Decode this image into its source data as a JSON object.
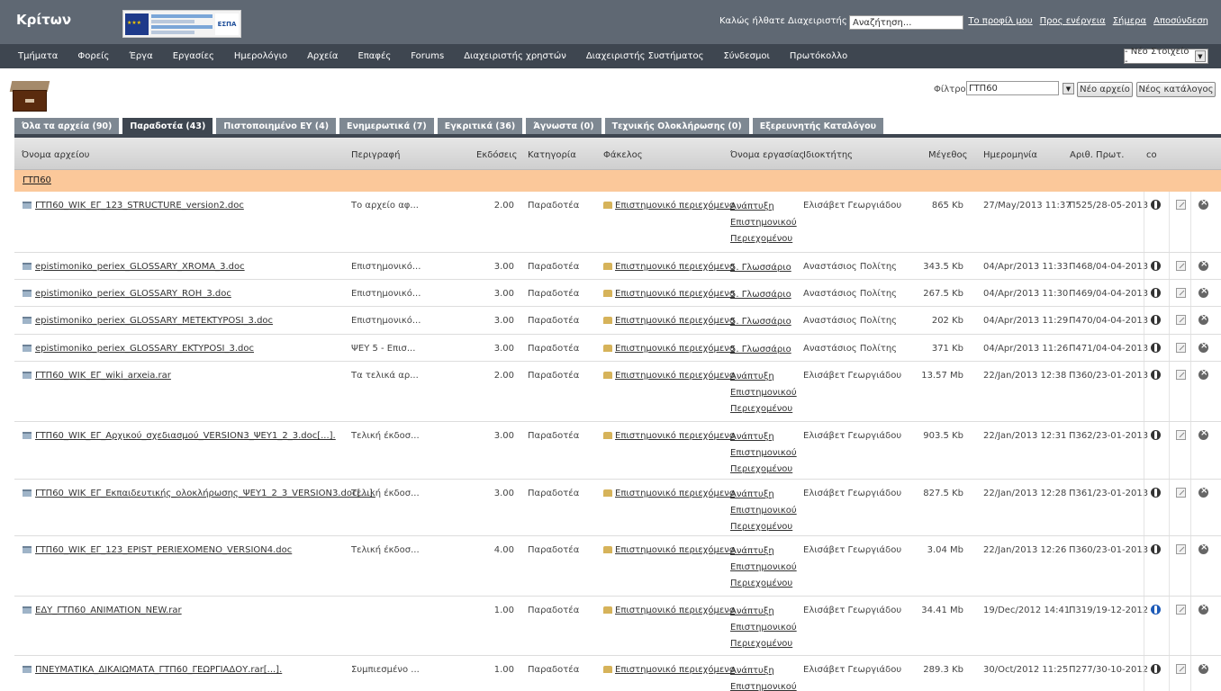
{
  "header": {
    "brand": "Κρίτων",
    "espa_logo": "ΕΣΠΑ",
    "welcome": "Καλώς ήλθατε Διαχειριστής",
    "search_value": "Αναζήτηση...",
    "links": [
      "Το προφίλ μου",
      "Προς ενέργεια",
      "Σήμερα",
      "Αποσύνδεση"
    ]
  },
  "nav": {
    "items": [
      "Τμήματα",
      "Φορείς",
      "Έργα",
      "Εργασίες",
      "Ημερολόγιο",
      "Αρχεία",
      "Επαφές",
      "Forums",
      "Διαχειριστής χρηστών",
      "Διαχειριστής Συστήματος",
      "Σύνδεσμοι",
      "Πρωτόκολλο"
    ],
    "new_item": "- Νέο Στοιχείο -"
  },
  "filter": {
    "label": "Φίλτρο:",
    "value": "ΓΤΠ60",
    "new_file": "Νέο αρχείο",
    "new_dir": "Νέος κατάλογος"
  },
  "tabs": [
    "Όλα τα αρχεία (90)",
    "Παραδοτέα (43)",
    "Πιστοποιημένο ΕΥ (4)",
    "Ενημερωτικά (7)",
    "Εγκριτικά (36)",
    "Άγνωστα (0)",
    "Τεχνικής Ολοκλήρωσης (0)",
    "Εξερευνητής Καταλόγου"
  ],
  "table": {
    "headers": [
      "Όνομα αρχείου",
      "Περιγραφή",
      "Εκδόσεις",
      "Κατηγορία",
      "Φάκελος",
      "Όνομα εργασίας",
      "Ιδιοκτήτης",
      "Μέγεθος",
      "Ημερομηνία",
      "Αριθ. Πρωτ.",
      "co"
    ],
    "group": "ΓΤΠ60",
    "rows": [
      {
        "name": "ΓΤΠ60_WIK_ΕΓ_123_STRUCTURE_version2.doc",
        "desc": "Το αρχείο αφ...",
        "ver": "2.00",
        "cat": "Παραδοτέα",
        "folder": "Επιστημονικό περιεχόμενο",
        "task": [
          "Ανάπτυξη",
          "Επιστημονικού",
          "Περιεχομένου"
        ],
        "owner": "Ελισάβετ Γεωργιάδου",
        "size": "865 Kb",
        "date": "27/May/2013 11:37",
        "prot": "Π525/28-05-2013"
      },
      {
        "name": "epistimoniko_periex_GLOSSARY_XROMA_3.doc",
        "desc": "Επιστημονικό...",
        "ver": "3.00",
        "cat": "Παραδοτέα",
        "folder": "Επιστημονικό περιεχόμενο",
        "task": [
          "5. Γλωσσάριο"
        ],
        "owner": "Αναστάσιος Πολίτης",
        "size": "343.5 Kb",
        "date": "04/Apr/2013 11:33",
        "prot": "Π468/04-04-2013"
      },
      {
        "name": "epistimoniko_periex_GLOSSARY_ROH_3.doc",
        "desc": "Επιστημονικό...",
        "ver": "3.00",
        "cat": "Παραδοτέα",
        "folder": "Επιστημονικό περιεχόμενο",
        "task": [
          "5. Γλωσσάριο"
        ],
        "owner": "Αναστάσιος Πολίτης",
        "size": "267.5 Kb",
        "date": "04/Apr/2013 11:30",
        "prot": "Π469/04-04-2013"
      },
      {
        "name": "epistimoniko_periex_GLOSSARY_METEKTYPOSI_3.doc",
        "desc": "Επιστημονικό...",
        "ver": "3.00",
        "cat": "Παραδοτέα",
        "folder": "Επιστημονικό περιεχόμενο",
        "task": [
          "5. Γλωσσάριο"
        ],
        "owner": "Αναστάσιος Πολίτης",
        "size": "202 Kb",
        "date": "04/Apr/2013 11:29",
        "prot": "Π470/04-04-2013"
      },
      {
        "name": "epistimoniko_periex_GLOSSARY_EKTYPOSI_3.doc",
        "desc": "ΨΕΥ 5 - Επισ...",
        "ver": "3.00",
        "cat": "Παραδοτέα",
        "folder": "Επιστημονικό περιεχόμενο",
        "task": [
          "5. Γλωσσάριο"
        ],
        "owner": "Αναστάσιος Πολίτης",
        "size": "371 Kb",
        "date": "04/Apr/2013 11:26",
        "prot": "Π471/04-04-2013"
      },
      {
        "name": "ΓΤΠ60_WIK_ΕΓ_wiki_arxeia.rar",
        "desc": "Τα τελικά αρ...",
        "ver": "2.00",
        "cat": "Παραδοτέα",
        "folder": "Επιστημονικό περιεχόμενο",
        "task": [
          "Ανάπτυξη",
          "Επιστημονικού",
          "Περιεχομένου"
        ],
        "owner": "Ελισάβετ Γεωργιάδου",
        "size": "13.57 Mb",
        "date": "22/Jan/2013 12:38",
        "prot": "Π360/23-01-2013"
      },
      {
        "name": "ΓΤΠ60_WIK_ΕΓ_Αρχικού_σχεδιασμού_VERSION3_ΨΕΥ1_2_3.doc[...].",
        "desc": "Τελική έκδοσ...",
        "ver": "3.00",
        "cat": "Παραδοτέα",
        "folder": "Επιστημονικό περιεχόμενο",
        "task": [
          "Ανάπτυξη",
          "Επιστημονικού",
          "Περιεχομένου"
        ],
        "owner": "Ελισάβετ Γεωργιάδου",
        "size": "903.5 Kb",
        "date": "22/Jan/2013 12:31",
        "prot": "Π362/23-01-2013"
      },
      {
        "name": "ΓΤΠ60_WIK_ΕΓ_Εκπαιδευτικής_ολοκλήρωσης_ΨΕΥ1_2_3_VERSION3.doc[...].",
        "desc": "Τελική έκδοσ...",
        "ver": "3.00",
        "cat": "Παραδοτέα",
        "folder": "Επιστημονικό περιεχόμενο",
        "task": [
          "Ανάπτυξη",
          "Επιστημονικού",
          "Περιεχομένου"
        ],
        "owner": "Ελισάβετ Γεωργιάδου",
        "size": "827.5 Kb",
        "date": "22/Jan/2013 12:28",
        "prot": "Π361/23-01-2013"
      },
      {
        "name": "ΓΤΠ60_WIK_ΕΓ_123_EPIST_PERIEXOMENO_VERSION4.doc",
        "desc": "Τελική έκδοσ...",
        "ver": "4.00",
        "cat": "Παραδοτέα",
        "folder": "Επιστημονικό περιεχόμενο",
        "task": [
          "Ανάπτυξη",
          "Επιστημονικού",
          "Περιεχομένου"
        ],
        "owner": "Ελισάβετ Γεωργιάδου",
        "size": "3.04 Mb",
        "date": "22/Jan/2013 12:26",
        "prot": "Π360/23-01-2013"
      },
      {
        "name": "ΕΔΥ_ΓΤΠ60_ANIMATION_NEW.rar",
        "desc": "",
        "ver": "1.00",
        "cat": "Παραδοτέα",
        "folder": "Επιστημονικό περιεχόμενο",
        "task": [
          "Ανάπτυξη",
          "Επιστημονικού",
          "Περιεχομένου"
        ],
        "owner": "Ελισάβετ Γεωργιάδου",
        "size": "34.41 Mb",
        "date": "19/Dec/2012 14:41",
        "prot": "Π319/19-12-2012"
      },
      {
        "name": "ΠΝΕΥΜΑΤΙΚΑ_ΔΙΚΑΙΩΜΑΤΑ_ΓΤΠ60_ΓΕΩΡΓΙΑΔΟΥ.rar[...].",
        "desc": "Συμπιεσμένο ...",
        "ver": "1.00",
        "cat": "Παραδοτέα",
        "folder": "Επιστημονικό περιεχόμενο",
        "task": [
          "Ανάπτυξη",
          "Επιστημονικού"
        ],
        "owner": "Ελισάβετ Γεωργιάδου",
        "size": "289.3 Kb",
        "date": "30/Oct/2012 11:25",
        "prot": "Π277/30-10-2012"
      }
    ]
  },
  "colors": {
    "topbar": "#5f6873",
    "navbar": "#3e4650",
    "group_row": "#fbc89a"
  }
}
